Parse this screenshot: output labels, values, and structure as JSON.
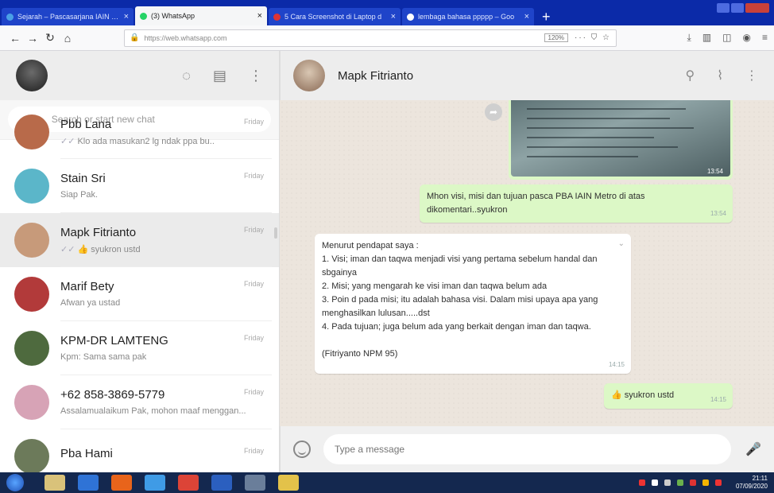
{
  "browser": {
    "tabs": [
      {
        "title": "Sejarah – Pascasarjana IAIN Me",
        "icon_color": "#4aa0e6",
        "active": false
      },
      {
        "title": "(3) WhatsApp",
        "icon_color": "#25d366",
        "active": true
      },
      {
        "title": "5 Cara Screenshot di Laptop d",
        "icon_color": "#d33",
        "active": false
      },
      {
        "title": "lembaga bahasa ppppp – Goo",
        "icon_color": "#fff",
        "active": false
      }
    ],
    "new_tab_label": "+",
    "url": "https://web.whatsapp.com",
    "zoom": "120%",
    "page_actions": "··· ⛉ ☆"
  },
  "sidebar": {
    "search_placeholder": "Search or start new chat",
    "chats": [
      {
        "name": "Pbb Lana",
        "time": "Friday",
        "message": "Klo ada masukan2 lg ndak ppa bu..",
        "ticks": true,
        "emoji": "",
        "avatar_color": "#b86a4a",
        "selected": false
      },
      {
        "name": "Stain Sri",
        "time": "Friday",
        "message": "Siap Pak.",
        "ticks": false,
        "emoji": "",
        "avatar_color": "#5bb6c9",
        "selected": false
      },
      {
        "name": "Mapk Fitrianto",
        "time": "Friday",
        "message": "syukron ustd",
        "ticks": true,
        "emoji": "👍",
        "avatar_color": "#c79a7a",
        "selected": true
      },
      {
        "name": "Marif Bety",
        "time": "Friday",
        "message": "Afwan ya ustad",
        "ticks": false,
        "emoji": "",
        "avatar_color": "#b23a3a",
        "selected": false
      },
      {
        "name": "KPM-DR LAMTENG",
        "time": "Friday",
        "message": "Kpm: Sama sama pak",
        "ticks": false,
        "emoji": "",
        "avatar_color": "#4e6a3e",
        "selected": false
      },
      {
        "name": "+62 858-3869-5779",
        "time": "Friday",
        "message": "Assalamualaikum Pak, mohon maaf menggan...",
        "ticks": false,
        "emoji": "",
        "avatar_color": "#d7a3b6",
        "selected": false
      },
      {
        "name": "Pba Hami",
        "time": "Friday",
        "message": "",
        "ticks": false,
        "emoji": "",
        "avatar_color": "#6c7a5a",
        "selected": false
      }
    ]
  },
  "conversation": {
    "contact_name": "Mapk Fitrianto",
    "image_time": "13:54",
    "msg_out_1": {
      "text": "Mhon visi, misi dan tujuan pasca PBA IAIN Metro di atas dikomentari..syukron",
      "time": "13:54"
    },
    "msg_in_1": {
      "lines": [
        "Menurut pendapat saya :",
        "1. Visi; iman dan taqwa menjadi visi yang pertama sebelum handal dan sbgainya",
        "2. Misi; yang mengarah ke visi iman dan taqwa belum ada",
        "3. Poin d pada misi; itu adalah bahasa visi. Dalam misi upaya apa yang menghasilkan lulusan.....dst",
        "4. Pada tujuan; juga belum ada yang berkait dengan iman dan taqwa.",
        "",
        "(Fitriyanto NPM 95)"
      ],
      "time": "14:15"
    },
    "msg_out_2": {
      "emoji": "👍",
      "text": "syukron ustd",
      "time": "14:15"
    },
    "input_placeholder": "Type a message"
  },
  "taskbar": {
    "apps": [
      "#d9c27a",
      "#2f73d6",
      "#e8641b",
      "#3f9be6",
      "#dc4437",
      "#2b5fbf",
      "#6a7e9a",
      "#e3c24a"
    ],
    "clock_time": "21:11",
    "clock_date": "07/09/2020"
  }
}
